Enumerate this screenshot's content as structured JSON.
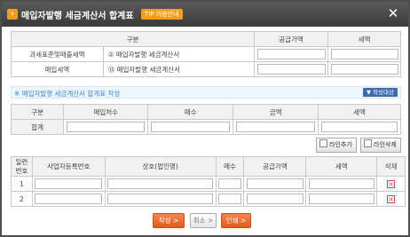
{
  "window": {
    "title": "매입자발행 세금계산서 합계표",
    "tip_badge": "TIP 이용안내",
    "close_glyph": "✕"
  },
  "summary_table": {
    "headers": [
      "구분",
      "공급가액",
      "세액"
    ],
    "rows": [
      {
        "category": "과세표준및매출세액",
        "item": "② 매입자발행 세금계산서"
      },
      {
        "category": "매입세액",
        "item": "⑬ 매입자발행 세금계산서"
      }
    ]
  },
  "note": {
    "text": "※ 매입자발행 세금계산서 합계표 작성",
    "mark_button": "▼ 작성대상"
  },
  "totals_table": {
    "headers": [
      "구분",
      "매입처수",
      "매수",
      "금액",
      "세액"
    ],
    "row_label": "합계"
  },
  "actions": {
    "add_row": "라인추가",
    "delete_row": "라인삭제"
  },
  "detail_table": {
    "headers": {
      "seq_line1": "일련",
      "seq_line2": "번호",
      "biz_no": "사업자등록번호",
      "company": "상호(법인명)",
      "count": "매수",
      "supply": "공급가액",
      "tax": "세액",
      "delete": "삭제"
    },
    "rows": [
      {
        "seq": "1"
      },
      {
        "seq": "2"
      }
    ]
  },
  "footer": {
    "write": "작성 >",
    "cancel": "취소 >",
    "print": "인쇄 >"
  },
  "colors": {
    "title_bar": "#3b3b3b",
    "accent_orange": "#e05a1c",
    "note_blue": "#3a86c8",
    "delete_red": "#d34b4b"
  },
  "icons": {
    "title": "chevron-right-icon",
    "close": "close-icon",
    "row_delete": "delete-x-icon"
  }
}
